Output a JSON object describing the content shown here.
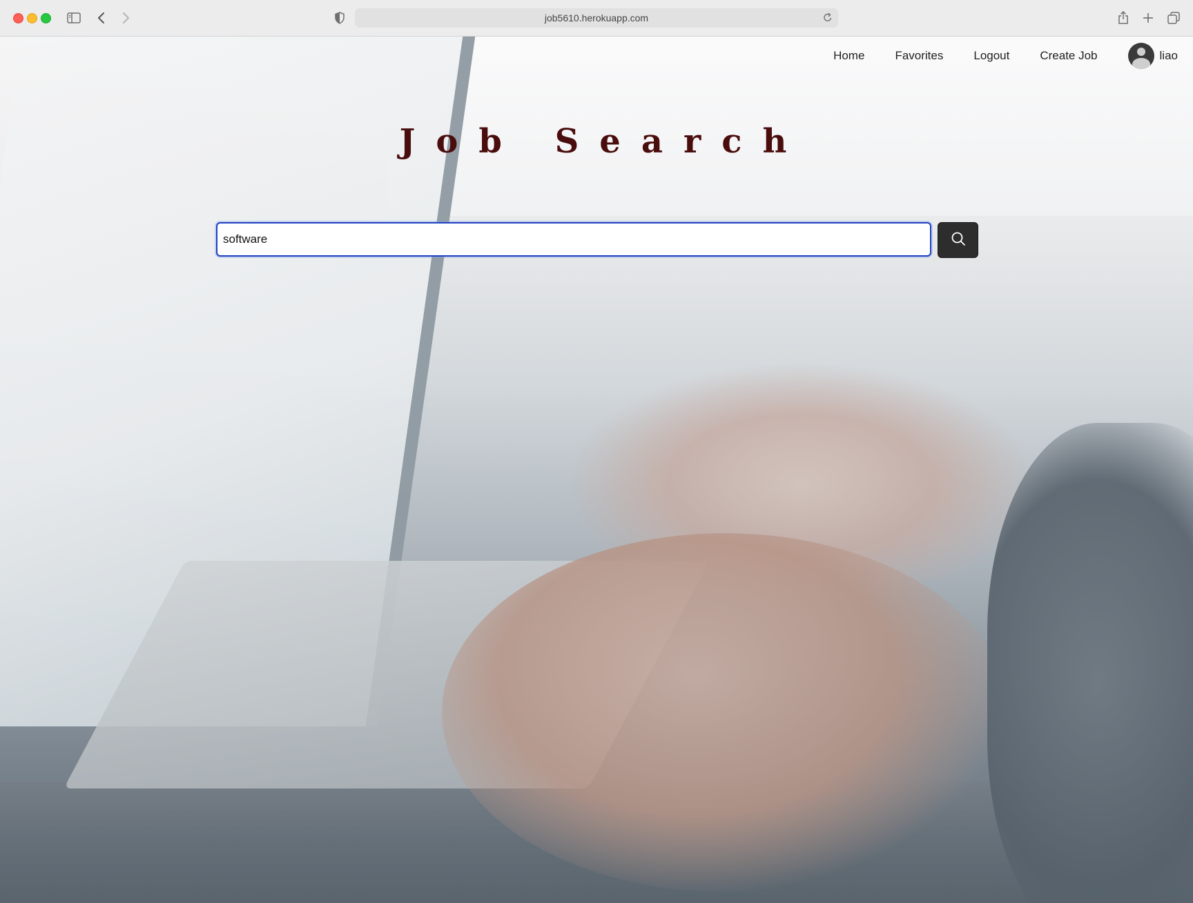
{
  "browser": {
    "url": "job5610.herokuapp.com",
    "icons": [
      "sidebar-icon",
      "back-icon",
      "forward-icon",
      "privacy-shield-icon",
      "reload-icon",
      "share-icon",
      "new-tab-icon",
      "tab-overview-icon"
    ]
  },
  "nav": {
    "items": [
      {
        "label": "Home"
      },
      {
        "label": "Favorites"
      },
      {
        "label": "Logout"
      },
      {
        "label": "Create Job"
      }
    ],
    "user": {
      "name": "liao",
      "avatar_icon": "user-avatar-icon"
    }
  },
  "main": {
    "title": "Job Search",
    "search": {
      "value": "software",
      "button_icon": "search-icon"
    }
  },
  "colors": {
    "title": "#4a0d0d",
    "search_focus_border": "#1f3fbf",
    "search_button": "#2d2d2d"
  }
}
